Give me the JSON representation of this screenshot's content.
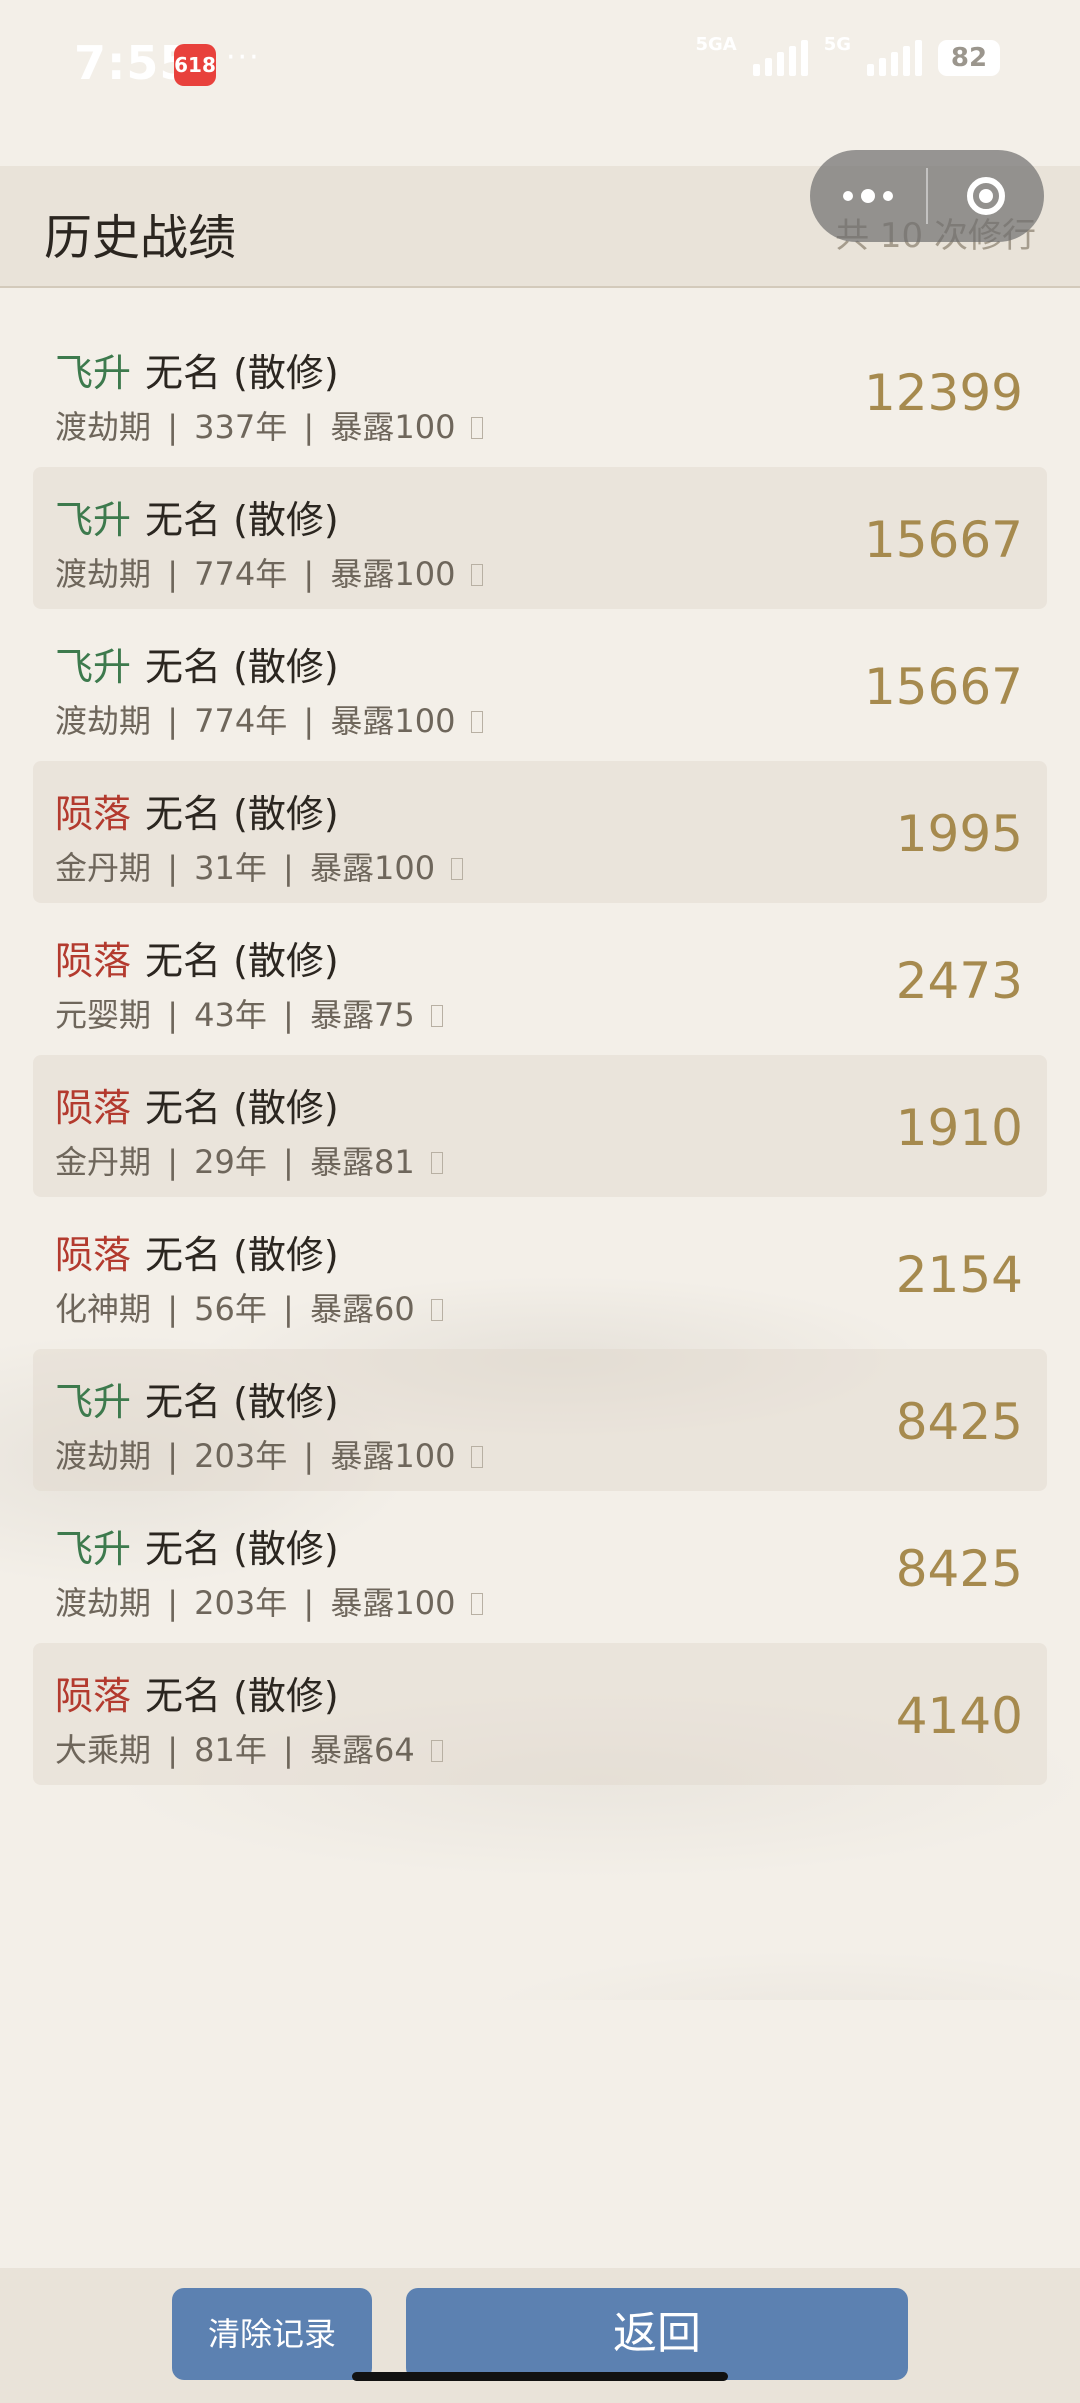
{
  "status_bar": {
    "time": "7:55",
    "app_badge": "618",
    "more": "···",
    "net1": "5GA",
    "net2": "5G",
    "battery": "82"
  },
  "header": {
    "title": "历史战绩",
    "run_count": "共 10 次修行"
  },
  "records": [
    {
      "outcome": "飞升",
      "outcome_type": "ascend",
      "name": "无名 (散修)",
      "realm": "渡劫期",
      "years": "337年",
      "exposure": "暴露100",
      "score": "12399"
    },
    {
      "outcome": "飞升",
      "outcome_type": "ascend",
      "name": "无名 (散修)",
      "realm": "渡劫期",
      "years": "774年",
      "exposure": "暴露100",
      "score": "15667"
    },
    {
      "outcome": "飞升",
      "outcome_type": "ascend",
      "name": "无名 (散修)",
      "realm": "渡劫期",
      "years": "774年",
      "exposure": "暴露100",
      "score": "15667"
    },
    {
      "outcome": "陨落",
      "outcome_type": "fall",
      "name": "无名 (散修)",
      "realm": "金丹期",
      "years": "31年",
      "exposure": "暴露100",
      "score": "1995"
    },
    {
      "outcome": "陨落",
      "outcome_type": "fall",
      "name": "无名 (散修)",
      "realm": "元婴期",
      "years": "43年",
      "exposure": "暴露75",
      "score": "2473"
    },
    {
      "outcome": "陨落",
      "outcome_type": "fall",
      "name": "无名 (散修)",
      "realm": "金丹期",
      "years": "29年",
      "exposure": "暴露81",
      "score": "1910"
    },
    {
      "outcome": "陨落",
      "outcome_type": "fall",
      "name": "无名 (散修)",
      "realm": "化神期",
      "years": "56年",
      "exposure": "暴露60",
      "score": "2154"
    },
    {
      "outcome": "飞升",
      "outcome_type": "ascend",
      "name": "无名 (散修)",
      "realm": "渡劫期",
      "years": "203年",
      "exposure": "暴露100",
      "score": "8425"
    },
    {
      "outcome": "飞升",
      "outcome_type": "ascend",
      "name": "无名 (散修)",
      "realm": "渡劫期",
      "years": "203年",
      "exposure": "暴露100",
      "score": "8425"
    },
    {
      "outcome": "陨落",
      "outcome_type": "fall",
      "name": "无名 (散修)",
      "realm": "大乘期",
      "years": "81年",
      "exposure": "暴露64",
      "score": "4140"
    }
  ],
  "buttons": {
    "clear_label": "清除记录",
    "back_label": "返回"
  },
  "colors": {
    "ascend": "#3d7a4d",
    "fall": "#b33a2e",
    "score": "#a68a4e",
    "button": "#5c81b1"
  }
}
